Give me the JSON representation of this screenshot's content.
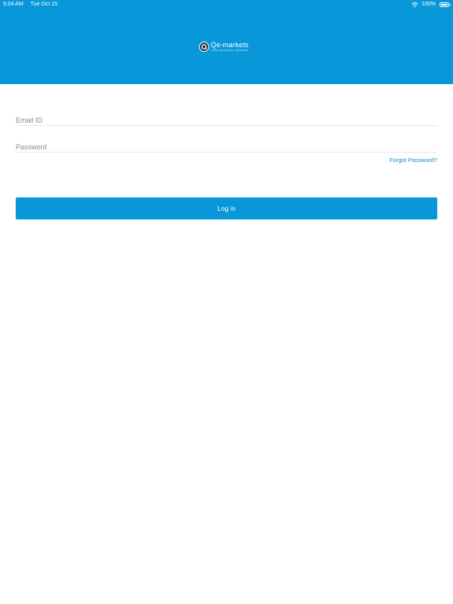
{
  "status_bar": {
    "time": "5:04 AM",
    "date": "Tue Oct 15",
    "wifi_icon": "wifi-icon",
    "battery_text": "100%",
    "battery_icon": "battery-icon"
  },
  "header": {
    "background_color": "#0897d9",
    "logo": {
      "mark_letter": "Q",
      "name": "e-markets",
      "tagline": "YOUR PERSONAL SHOPPER"
    }
  },
  "form": {
    "email": {
      "placeholder": "Email ID",
      "value": ""
    },
    "password": {
      "placeholder": "Password",
      "value": ""
    },
    "forgot_password_label": "Forgot Password?",
    "login_label": "Log in"
  },
  "colors": {
    "accent": "#0897d9",
    "link": "#1488cc"
  }
}
